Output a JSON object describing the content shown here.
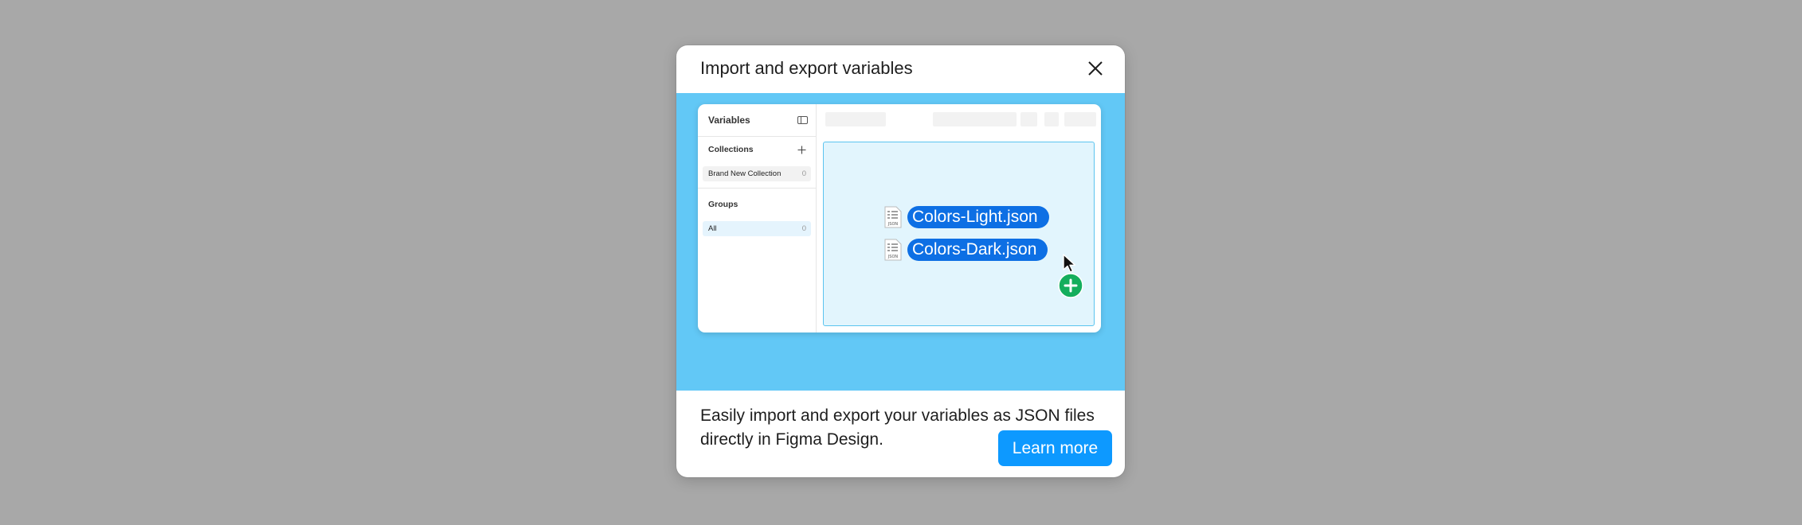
{
  "modal": {
    "title": "Import and export variables",
    "description": "Easily import and export your variables as JSON files directly in Figma Design.",
    "learn_more_label": "Learn more",
    "close_icon": "close-icon"
  },
  "illustration": {
    "panel_title": "Variables",
    "collections_label": "Collections",
    "collection_name": "Brand New Collection",
    "collection_count": "0",
    "groups_label": "Groups",
    "group_name": "All",
    "group_count": "0",
    "files": [
      {
        "name": "Colors-Light.json",
        "icon_label": "JSON"
      },
      {
        "name": "Colors-Dark.json",
        "icon_label": "JSON"
      }
    ]
  },
  "colors": {
    "overlay": "#a8a8a8",
    "hero_background": "#62c8f6",
    "primary_button": "#0d99ff",
    "file_chip": "#0d6fe4",
    "drop_zone": "#e2f5fd",
    "add_badge": "#14ae5c"
  }
}
